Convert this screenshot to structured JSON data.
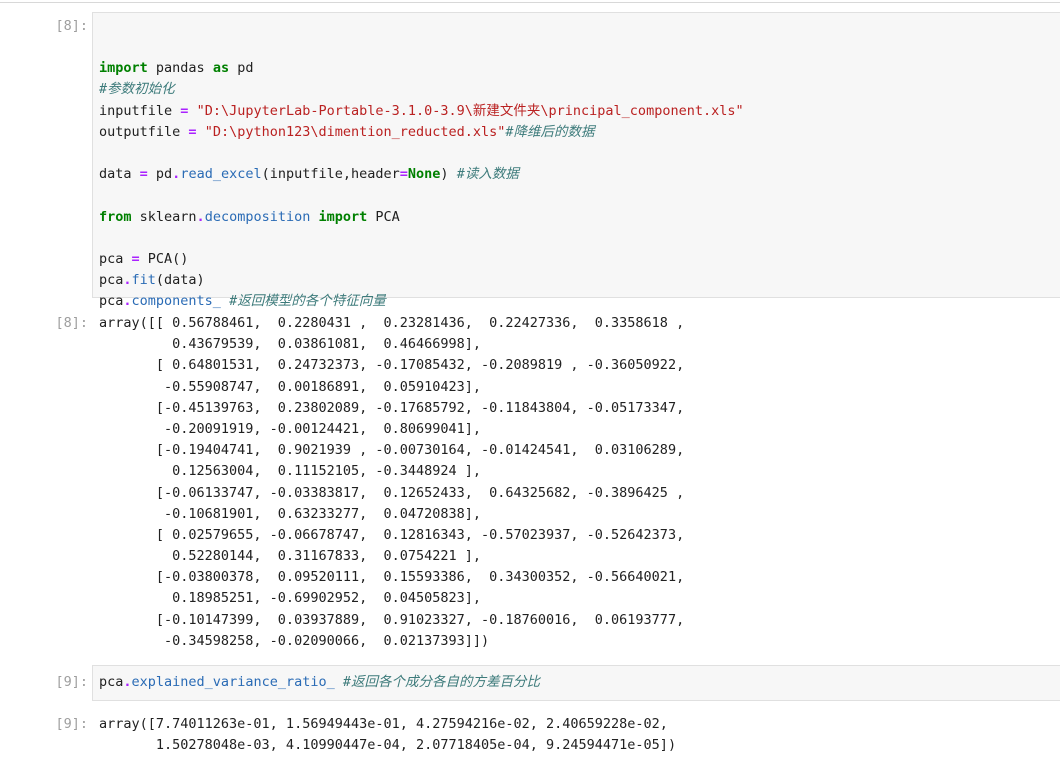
{
  "cells": [
    {
      "prompt_in": "[8]:",
      "code_lines": [
        [],
        [
          [
            "kw",
            "import"
          ],
          [
            "t",
            " pandas "
          ],
          [
            "kw",
            "as"
          ],
          [
            "t",
            " pd"
          ]
        ],
        [
          [
            "cm",
            "#参数初始化"
          ]
        ],
        [
          [
            "t",
            "inputfile "
          ],
          [
            "op",
            "="
          ],
          [
            "t",
            " "
          ],
          [
            "str",
            "\"D:\\JupyterLab-Portable-3.1.0-3.9\\新建文件夹\\principal_component.xls\""
          ]
        ],
        [
          [
            "t",
            "outputfile "
          ],
          [
            "op",
            "="
          ],
          [
            "t",
            " "
          ],
          [
            "str",
            "\"D:\\python123\\dimention_reducted.xls\""
          ],
          [
            "cm",
            "#降维后的数据"
          ]
        ],
        [],
        [
          [
            "t",
            "data "
          ],
          [
            "op",
            "="
          ],
          [
            "t",
            " pd"
          ],
          [
            "op",
            "."
          ],
          [
            "attr",
            "read_excel"
          ],
          [
            "t",
            "(inputfile,header"
          ],
          [
            "op",
            "="
          ],
          [
            "kw",
            "None"
          ],
          [
            "t",
            ") "
          ],
          [
            "cm",
            "#读入数据"
          ]
        ],
        [],
        [
          [
            "kw",
            "from"
          ],
          [
            "t",
            " sklearn"
          ],
          [
            "op",
            "."
          ],
          [
            "attr",
            "decomposition"
          ],
          [
            "t",
            " "
          ],
          [
            "kw",
            "import"
          ],
          [
            "t",
            " PCA"
          ]
        ],
        [],
        [
          [
            "t",
            "pca "
          ],
          [
            "op",
            "="
          ],
          [
            "t",
            " PCA()"
          ]
        ],
        [
          [
            "t",
            "pca"
          ],
          [
            "op",
            "."
          ],
          [
            "attr",
            "fit"
          ],
          [
            "t",
            "(data)"
          ]
        ],
        [
          [
            "t",
            "pca"
          ],
          [
            "op",
            "."
          ],
          [
            "attr",
            "components_"
          ],
          [
            "t",
            " "
          ],
          [
            "cm",
            "#返回模型的各个特征向量"
          ]
        ]
      ],
      "prompt_out": "[8]:",
      "output_lines": [
        "array([[ 0.56788461,  0.2280431 ,  0.23281436,  0.22427336,  0.3358618 ,",
        "         0.43679539,  0.03861081,  0.46466998],",
        "       [ 0.64801531,  0.24732373, -0.17085432, -0.2089819 , -0.36050922,",
        "        -0.55908747,  0.00186891,  0.05910423],",
        "       [-0.45139763,  0.23802089, -0.17685792, -0.11843804, -0.05173347,",
        "        -0.20091919, -0.00124421,  0.80699041],",
        "       [-0.19404741,  0.9021939 , -0.00730164, -0.01424541,  0.03106289,",
        "         0.12563004,  0.11152105, -0.3448924 ],",
        "       [-0.06133747, -0.03383817,  0.12652433,  0.64325682, -0.3896425 ,",
        "        -0.10681901,  0.63233277,  0.04720838],",
        "       [ 0.02579655, -0.06678747,  0.12816343, -0.57023937, -0.52642373,",
        "         0.52280144,  0.31167833,  0.0754221 ],",
        "       [-0.03800378,  0.09520111,  0.15593386,  0.34300352, -0.56640021,",
        "         0.18985251, -0.69902952,  0.04505823],",
        "       [-0.10147399,  0.03937889,  0.91023327, -0.18760016,  0.06193777,",
        "        -0.34598258, -0.02090066,  0.02137393]])"
      ]
    },
    {
      "prompt_in": "[9]:",
      "code_lines": [
        [
          [
            "t",
            "pca"
          ],
          [
            "op",
            "."
          ],
          [
            "attr",
            "explained_variance_ratio_"
          ],
          [
            "t",
            " "
          ],
          [
            "cm",
            "#返回各个成分各自的方差百分比"
          ]
        ]
      ],
      "prompt_out": "[9]:",
      "output_lines": [
        "array([7.74011263e-01, 1.56949443e-01, 4.27594216e-02, 2.40659228e-02,",
        "       1.50278048e-03, 4.10990447e-04, 2.07718405e-04, 9.24594471e-05])"
      ]
    }
  ]
}
